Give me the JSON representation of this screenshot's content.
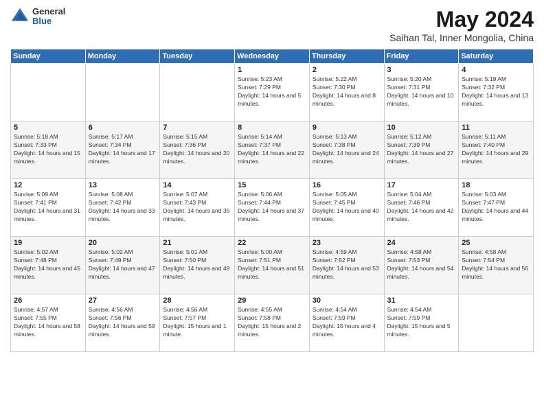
{
  "header": {
    "logo_general": "General",
    "logo_blue": "Blue",
    "title": "May 2024",
    "subtitle": "Saihan Tal, Inner Mongolia, China"
  },
  "days_of_week": [
    "Sunday",
    "Monday",
    "Tuesday",
    "Wednesday",
    "Thursday",
    "Friday",
    "Saturday"
  ],
  "weeks": [
    [
      {
        "day": "",
        "sunrise": "",
        "sunset": "",
        "daylight": ""
      },
      {
        "day": "",
        "sunrise": "",
        "sunset": "",
        "daylight": ""
      },
      {
        "day": "",
        "sunrise": "",
        "sunset": "",
        "daylight": ""
      },
      {
        "day": "1",
        "sunrise": "Sunrise: 5:23 AM",
        "sunset": "Sunset: 7:29 PM",
        "daylight": "Daylight: 14 hours and 5 minutes."
      },
      {
        "day": "2",
        "sunrise": "Sunrise: 5:22 AM",
        "sunset": "Sunset: 7:30 PM",
        "daylight": "Daylight: 14 hours and 8 minutes."
      },
      {
        "day": "3",
        "sunrise": "Sunrise: 5:20 AM",
        "sunset": "Sunset: 7:31 PM",
        "daylight": "Daylight: 14 hours and 10 minutes."
      },
      {
        "day": "4",
        "sunrise": "Sunrise: 5:19 AM",
        "sunset": "Sunset: 7:32 PM",
        "daylight": "Daylight: 14 hours and 13 minutes."
      }
    ],
    [
      {
        "day": "5",
        "sunrise": "Sunrise: 5:18 AM",
        "sunset": "Sunset: 7:33 PM",
        "daylight": "Daylight: 14 hours and 15 minutes."
      },
      {
        "day": "6",
        "sunrise": "Sunrise: 5:17 AM",
        "sunset": "Sunset: 7:34 PM",
        "daylight": "Daylight: 14 hours and 17 minutes."
      },
      {
        "day": "7",
        "sunrise": "Sunrise: 5:15 AM",
        "sunset": "Sunset: 7:36 PM",
        "daylight": "Daylight: 14 hours and 20 minutes."
      },
      {
        "day": "8",
        "sunrise": "Sunrise: 5:14 AM",
        "sunset": "Sunset: 7:37 PM",
        "daylight": "Daylight: 14 hours and 22 minutes."
      },
      {
        "day": "9",
        "sunrise": "Sunrise: 5:13 AM",
        "sunset": "Sunset: 7:38 PM",
        "daylight": "Daylight: 14 hours and 24 minutes."
      },
      {
        "day": "10",
        "sunrise": "Sunrise: 5:12 AM",
        "sunset": "Sunset: 7:39 PM",
        "daylight": "Daylight: 14 hours and 27 minutes."
      },
      {
        "day": "11",
        "sunrise": "Sunrise: 5:11 AM",
        "sunset": "Sunset: 7:40 PM",
        "daylight": "Daylight: 14 hours and 29 minutes."
      }
    ],
    [
      {
        "day": "12",
        "sunrise": "Sunrise: 5:09 AM",
        "sunset": "Sunset: 7:41 PM",
        "daylight": "Daylight: 14 hours and 31 minutes."
      },
      {
        "day": "13",
        "sunrise": "Sunrise: 5:08 AM",
        "sunset": "Sunset: 7:42 PM",
        "daylight": "Daylight: 14 hours and 33 minutes."
      },
      {
        "day": "14",
        "sunrise": "Sunrise: 5:07 AM",
        "sunset": "Sunset: 7:43 PM",
        "daylight": "Daylight: 14 hours and 35 minutes."
      },
      {
        "day": "15",
        "sunrise": "Sunrise: 5:06 AM",
        "sunset": "Sunset: 7:44 PM",
        "daylight": "Daylight: 14 hours and 37 minutes."
      },
      {
        "day": "16",
        "sunrise": "Sunrise: 5:05 AM",
        "sunset": "Sunset: 7:45 PM",
        "daylight": "Daylight: 14 hours and 40 minutes."
      },
      {
        "day": "17",
        "sunrise": "Sunrise: 5:04 AM",
        "sunset": "Sunset: 7:46 PM",
        "daylight": "Daylight: 14 hours and 42 minutes."
      },
      {
        "day": "18",
        "sunrise": "Sunrise: 5:03 AM",
        "sunset": "Sunset: 7:47 PM",
        "daylight": "Daylight: 14 hours and 44 minutes."
      }
    ],
    [
      {
        "day": "19",
        "sunrise": "Sunrise: 5:02 AM",
        "sunset": "Sunset: 7:48 PM",
        "daylight": "Daylight: 14 hours and 45 minutes."
      },
      {
        "day": "20",
        "sunrise": "Sunrise: 5:02 AM",
        "sunset": "Sunset: 7:49 PM",
        "daylight": "Daylight: 14 hours and 47 minutes."
      },
      {
        "day": "21",
        "sunrise": "Sunrise: 5:01 AM",
        "sunset": "Sunset: 7:50 PM",
        "daylight": "Daylight: 14 hours and 49 minutes."
      },
      {
        "day": "22",
        "sunrise": "Sunrise: 5:00 AM",
        "sunset": "Sunset: 7:51 PM",
        "daylight": "Daylight: 14 hours and 51 minutes."
      },
      {
        "day": "23",
        "sunrise": "Sunrise: 4:59 AM",
        "sunset": "Sunset: 7:52 PM",
        "daylight": "Daylight: 14 hours and 53 minutes."
      },
      {
        "day": "24",
        "sunrise": "Sunrise: 4:58 AM",
        "sunset": "Sunset: 7:53 PM",
        "daylight": "Daylight: 14 hours and 54 minutes."
      },
      {
        "day": "25",
        "sunrise": "Sunrise: 4:58 AM",
        "sunset": "Sunset: 7:54 PM",
        "daylight": "Daylight: 14 hours and 56 minutes."
      }
    ],
    [
      {
        "day": "26",
        "sunrise": "Sunrise: 4:57 AM",
        "sunset": "Sunset: 7:55 PM",
        "daylight": "Daylight: 14 hours and 58 minutes."
      },
      {
        "day": "27",
        "sunrise": "Sunrise: 4:56 AM",
        "sunset": "Sunset: 7:56 PM",
        "daylight": "Daylight: 14 hours and 59 minutes."
      },
      {
        "day": "28",
        "sunrise": "Sunrise: 4:56 AM",
        "sunset": "Sunset: 7:57 PM",
        "daylight": "Daylight: 15 hours and 1 minute."
      },
      {
        "day": "29",
        "sunrise": "Sunrise: 4:55 AM",
        "sunset": "Sunset: 7:58 PM",
        "daylight": "Daylight: 15 hours and 2 minutes."
      },
      {
        "day": "30",
        "sunrise": "Sunrise: 4:54 AM",
        "sunset": "Sunset: 7:59 PM",
        "daylight": "Daylight: 15 hours and 4 minutes."
      },
      {
        "day": "31",
        "sunrise": "Sunrise: 4:54 AM",
        "sunset": "Sunset: 7:59 PM",
        "daylight": "Daylight: 15 hours and 5 minutes."
      },
      {
        "day": "",
        "sunrise": "",
        "sunset": "",
        "daylight": ""
      }
    ]
  ]
}
